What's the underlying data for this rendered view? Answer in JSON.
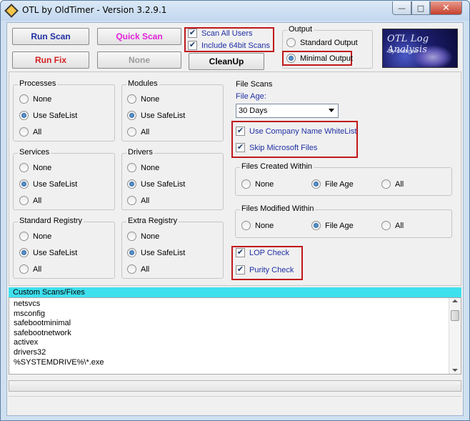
{
  "window": {
    "title": "OTL by OldTimer - Version 3.2.9.1",
    "controls": {
      "minimize": "—",
      "maximize": "□",
      "close": "✕"
    }
  },
  "toolbar": {
    "run_scan": "Run Scan",
    "quick_scan": "Quick Scan",
    "run_fix": "Run Fix",
    "none": "None",
    "cleanup": "CleanUp",
    "scan_all_users": "Scan All Users",
    "include_64bit": "Include 64bit Scans"
  },
  "output": {
    "title": "Output",
    "standard": "Standard Output",
    "minimal": "Minimal Output",
    "selected": "minimal"
  },
  "logo": {
    "line1": "OTL Log Analysis",
    "line2": "By Oldtimer"
  },
  "groups": {
    "processes": {
      "title": "Processes",
      "options": [
        "None",
        "Use SafeList",
        "All"
      ],
      "selected": 1
    },
    "modules": {
      "title": "Modules",
      "options": [
        "None",
        "Use SafeList",
        "All"
      ],
      "selected": 1
    },
    "services": {
      "title": "Services",
      "options": [
        "None",
        "Use SafeList",
        "All"
      ],
      "selected": 1
    },
    "drivers": {
      "title": "Drivers",
      "options": [
        "None",
        "Use SafeList",
        "All"
      ],
      "selected": 1
    },
    "standard_registry": {
      "title": "Standard Registry",
      "options": [
        "None",
        "Use SafeList",
        "All"
      ],
      "selected": 1
    },
    "extra_registry": {
      "title": "Extra Registry",
      "options": [
        "None",
        "Use SafeList",
        "All"
      ],
      "selected": 1
    }
  },
  "file_scans": {
    "title": "File Scans",
    "file_age_label": "File Age:",
    "file_age_value": "30 Days",
    "use_company_whitelist": "Use Company Name WhiteList",
    "skip_microsoft": "Skip Microsoft Files",
    "created_within": {
      "title": "Files Created Within",
      "options": [
        "None",
        "File Age",
        "All"
      ],
      "selected": 1
    },
    "modified_within": {
      "title": "Files Modified Within",
      "options": [
        "None",
        "File Age",
        "All"
      ],
      "selected": 1
    },
    "lop_check": "LOP Check",
    "purity_check": "Purity Check"
  },
  "custom": {
    "header": "Custom Scans/Fixes",
    "lines": [
      "netsvcs",
      "msconfig",
      "safebootminimal",
      "safebootnetwork",
      "activex",
      "drivers32",
      "%SYSTEMDRIVE%\\*.exe"
    ]
  },
  "colors": {
    "highlight_box": "#c0181a",
    "custom_header_bg": "#3fe0ee",
    "run_scan": "#1f2fa3",
    "quick_scan": "#e020d8",
    "run_fix": "#d42020"
  }
}
